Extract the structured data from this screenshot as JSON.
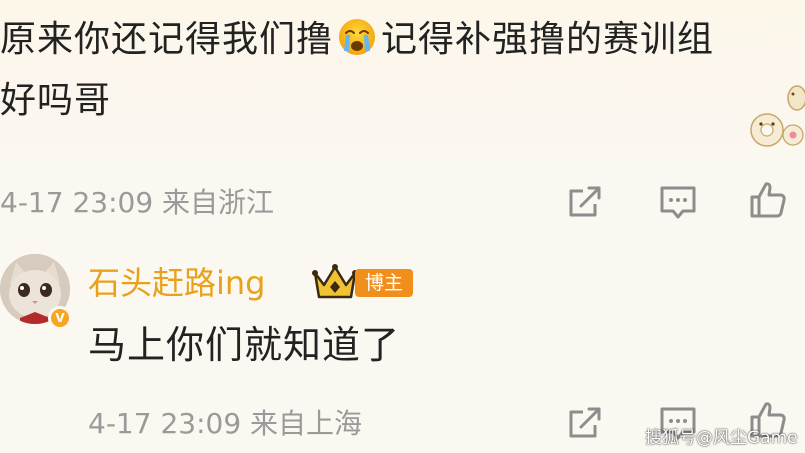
{
  "comment": {
    "line1_before": "原来你还记得我们撸",
    "emoji": "crying-face",
    "line1_after": "记得补强撸的赛训组",
    "line2": "好吗哥",
    "time": "4-17 23:09",
    "location": "来自浙江"
  },
  "reply": {
    "username": "石头赶路ing",
    "badge": "博主",
    "text": "马上你们就知道了",
    "time": "4-17 23:09",
    "location": "来自上海"
  },
  "watermark": "搜狐号@风尘Game",
  "colors": {
    "username": "#e8a21a",
    "badge": "#f18f1d",
    "meta": "#9a9a9a",
    "icon": "#8d8d8d"
  }
}
